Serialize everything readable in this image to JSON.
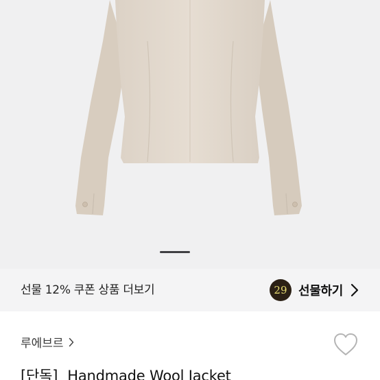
{
  "carousel": {
    "slide_alt": "Beige wool jacket back view",
    "indicator": "page-indicator"
  },
  "gift_bar": {
    "promo_text": "선물 12% 쿠폰 상품 더보기",
    "badge_number": "29",
    "gift_label": "선물하기",
    "chevron_icon": "chevron-right-icon"
  },
  "product": {
    "brand": "루에브르",
    "brand_chevron_icon": "chevron-right-icon",
    "wishlist_icon": "heart-outline-icon",
    "tag": "[단독]",
    "title": "Handmade Wool Jacket"
  },
  "colors": {
    "jacket": "#e3d9cd",
    "hero_bg": "#f0f0f1",
    "badge_bg": "#2b2015",
    "badge_text": "#e8dc72"
  }
}
